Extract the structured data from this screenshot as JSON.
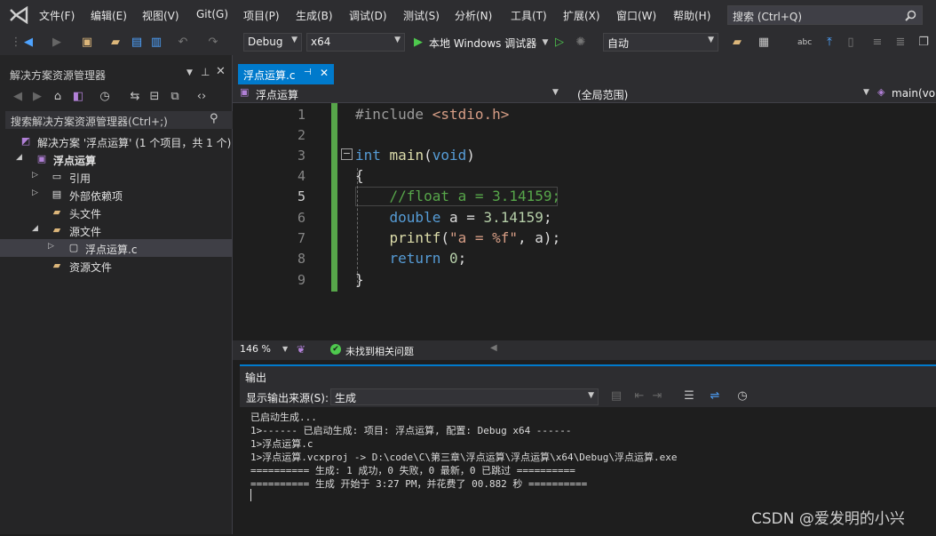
{
  "menu": {
    "items": [
      "文件(F)",
      "编辑(E)",
      "视图(V)",
      "Git(G)",
      "项目(P)",
      "生成(B)",
      "调试(D)",
      "测试(S)",
      "分析(N)",
      "工具(T)",
      "扩展(X)",
      "窗口(W)",
      "帮助(H)"
    ],
    "search_placeholder": "搜索 (Ctrl+Q)"
  },
  "toolbar": {
    "config": "Debug",
    "platform": "x64",
    "run_label": "本地 Windows 调试器",
    "auto_label": "自动"
  },
  "solution_explorer": {
    "title": "解决方案资源管理器",
    "search_placeholder": "搜索解决方案资源管理器(Ctrl+;)",
    "solution_label": "解决方案 '浮点运算' (1 个项目，共 1 个)",
    "project": "浮点运算",
    "nodes": {
      "references": "引用",
      "external_deps": "外部依赖项",
      "headers": "头文件",
      "sources": "源文件",
      "source_file": "浮点运算.c",
      "resources": "资源文件"
    }
  },
  "editor": {
    "tab_label": "浮点运算.c",
    "nav_file": "浮点运算",
    "nav_scope": "(全局范围)",
    "nav_function": "main(voi",
    "line_numbers": [
      "1",
      "2",
      "3",
      "4",
      "5",
      "6",
      "7",
      "8",
      "9"
    ],
    "zoom": "146 %",
    "issues_text": "未找到相关问题"
  },
  "output": {
    "title": "输出",
    "source_label": "显示输出来源(S):",
    "source_value": "生成",
    "lines": [
      "已启动生成...",
      "1>------ 已启动生成: 项目: 浮点运算, 配置: Debug x64 ------",
      "1>浮点运算.c",
      "1>浮点运算.vcxproj -> D:\\code\\C\\第三章\\浮点运算\\浮点运算\\x64\\Debug\\浮点运算.exe",
      "========== 生成: 1 成功，0 失败，0 最新，0 已跳过 ==========",
      "========== 生成 开始于 3:27 PM，并花费了 00.882 秒 =========="
    ]
  },
  "watermark": "CSDN @爱发明的小兴",
  "colors": {
    "accent": "#007acc",
    "keyword": "#569cd6",
    "comment": "#57a64a",
    "string": "#d69d85",
    "change_bar": "#57a64a"
  }
}
